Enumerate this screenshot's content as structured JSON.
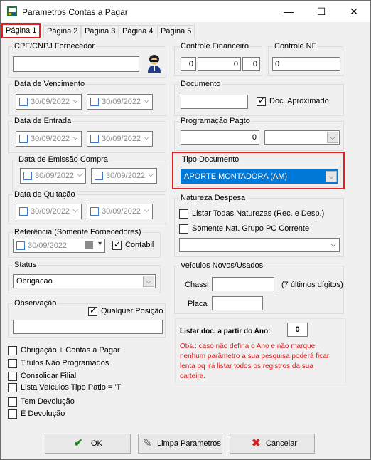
{
  "window": {
    "title": "Parametros Contas a Pagar",
    "minimize": "—",
    "maximize": "☐",
    "close": "✕"
  },
  "tabs": [
    "Página 1",
    "Página 2",
    "Página 3",
    "Página 4",
    "Página 5"
  ],
  "cpf": {
    "label": "CPF/CNPJ Fornecedor",
    "value": ""
  },
  "controle_financeiro": {
    "label": "Controle Financeiro",
    "v1": "0",
    "v2": "0",
    "v3": "0"
  },
  "controle_nf": {
    "label": "Controle NF",
    "value": "0"
  },
  "vencimento": {
    "label": "Data de Vencimento",
    "from": "30/09/2022",
    "to": "30/09/2022"
  },
  "documento": {
    "label": "Documento",
    "value": "",
    "aprox_label": "Doc. Aproximado",
    "aprox_checked": true
  },
  "entrada": {
    "label": "Data de Entrada",
    "from": "30/09/2022",
    "to": "30/09/2022"
  },
  "programacao": {
    "label": "Programação Pagto",
    "value": "0",
    "select": ""
  },
  "emissao": {
    "label": "Data de Emissão Compra",
    "from": "30/09/2022",
    "to": "30/09/2022"
  },
  "tipo_documento": {
    "label": "Tipo Documento",
    "value": "APORTE MONTADORA (AM)"
  },
  "quitacao": {
    "label": "Data de Quitação",
    "from": "30/09/2022",
    "to": "30/09/2022"
  },
  "natureza": {
    "label": "Natureza Despesa",
    "opt1": "Listar Todas Naturezas (Rec. e Desp.)",
    "opt2": "Somente Nat. Grupo PC Corrente",
    "select": ""
  },
  "referencia": {
    "label": "Referência (Somente Fornecedores)",
    "date": "30/09/2022",
    "contabil": "Contabil"
  },
  "status": {
    "label": "Status",
    "value": "Obrigacao"
  },
  "veiculos": {
    "label": "Veículos Novos/Usados",
    "chassi": "Chassi",
    "chassi_hint": "(7 últimos dígitos)",
    "placa": "Placa"
  },
  "observacao": {
    "label": "Observação",
    "qualquer": "Qualquer Posição",
    "value": ""
  },
  "ano": {
    "label": "Listar doc.  a partir do Ano:",
    "value": "0",
    "note": "Obs.: caso não defina o Ano e não marque nenhum parâmetro a sua pesquisa poderá ficar lenta pq irá listar todos os registros da sua carteira."
  },
  "options": [
    "Obrigação + Contas a Pagar",
    "Titulos Não Programados",
    "Consolidar Filial",
    "Lista Veículos Tipo Patio = 'T'",
    "Tem Devolução",
    "É Devolução"
  ],
  "buttons": {
    "ok": "OK",
    "limpa": "Limpa Parametros",
    "cancelar": "Cancelar"
  }
}
